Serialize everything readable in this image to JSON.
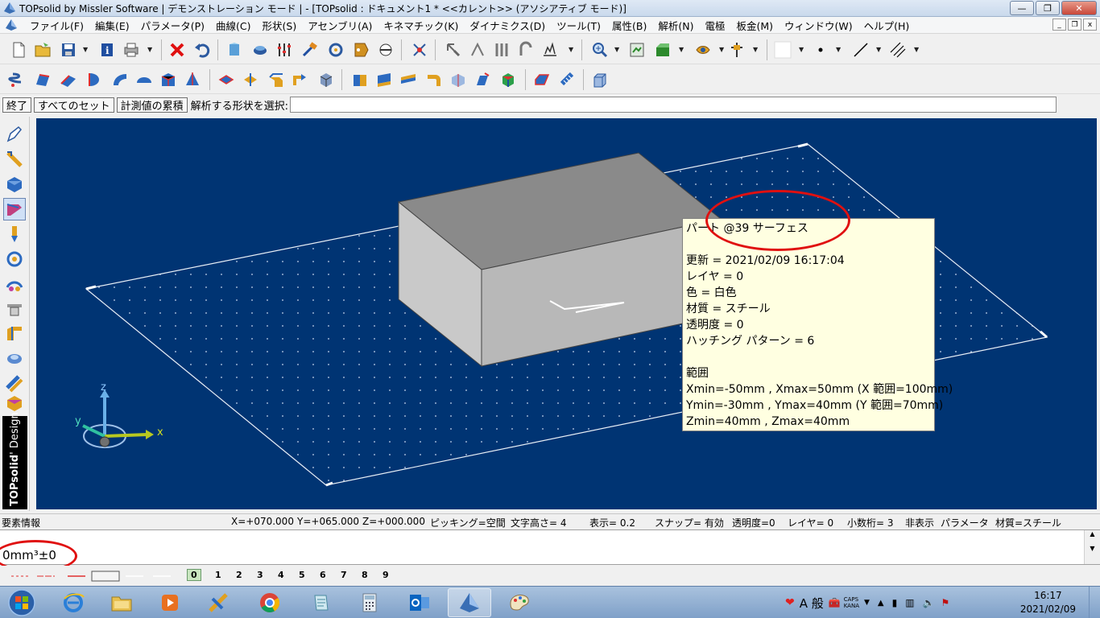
{
  "window": {
    "title": "TOPsolid by Missler Software | デモンストレーション モード | - [TOPsolid : ドキュメント1 *  <<カレント>> (アソシアティブ モード)]",
    "controls": {
      "minimize": "—",
      "maximize": "❐",
      "close": "✕"
    }
  },
  "menu": {
    "items": [
      "ファイル(F)",
      "編集(E)",
      "パラメータ(P)",
      "曲線(C)",
      "形状(S)",
      "アセンブリ(A)",
      "キネマチック(K)",
      "ダイナミクス(D)",
      "ツール(T)",
      "属性(B)",
      "解析(N)",
      "電極",
      "板金(M)",
      "ウィンドウ(W)",
      "ヘルプ(H)"
    ],
    "mdi": {
      "minimize": "_",
      "restore": "❐",
      "close": "x"
    }
  },
  "command_bar": {
    "end_label": "終了",
    "all_sets_label": "すべてのセット",
    "accumulate_label": "計測値の累積",
    "prompt": "解析する形状を選択:",
    "input_value": ""
  },
  "left_palette": {
    "brand_name": "TOPsolid",
    "brand_suffix": "' Design"
  },
  "viewport": {
    "axis_labels": {
      "x": "x",
      "y": "y",
      "z": "z"
    },
    "background_color": "#003473"
  },
  "tooltip": {
    "title": "パート @39 サーフェス",
    "lines": [
      "",
      "更新 = 2021/02/09 16:17:04",
      "レイヤ = 0",
      "色 = 白色",
      "材質 = スチール",
      "透明度 = 0",
      "ハッチング パターン = 6",
      "",
      "範囲",
      "Xmin=-50mm , Xmax=50mm (X 範囲=100mm)",
      "Ymin=-30mm , Ymax=40mm (Y 範囲=70mm)",
      "Zmin=40mm , Zmax=40mm"
    ]
  },
  "status_bar": {
    "left_label": "要素情報",
    "x": "X=+070.000",
    "y": "Y=+065.000",
    "z": "Z=+000.000",
    "picking": "ピッキング=空間",
    "text_height": "文字高さ=  4",
    "display": "表示=   0.2",
    "snap": "スナップ= 有効",
    "transparency": "透明度=0",
    "layer": "レイヤ=  0",
    "decimals": "小数桁= 3",
    "hidden": "非表示",
    "parameter": "パラメータ",
    "material": "材質=スチール"
  },
  "output": {
    "text": "0mm³±0"
  },
  "layer_bar": {
    "numbers": [
      "0",
      "1",
      "2",
      "3",
      "4",
      "5",
      "6",
      "7",
      "8",
      "9"
    ]
  },
  "taskbar": {
    "ime_mode": "A 般",
    "caps": "CAPS",
    "kana": "KANA",
    "time": "16:17",
    "date": "2021/02/09"
  }
}
